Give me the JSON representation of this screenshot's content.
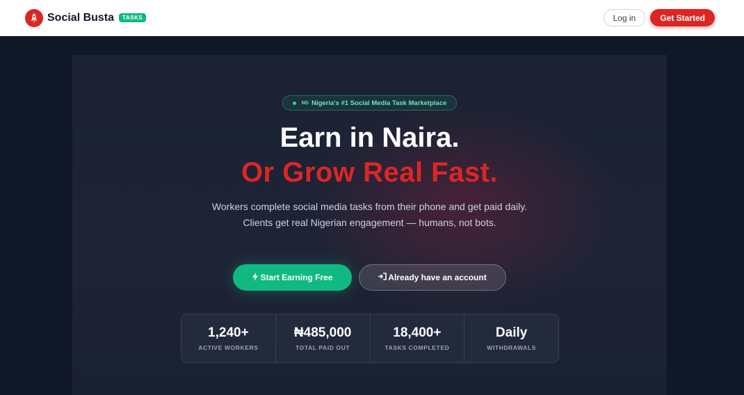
{
  "nav": {
    "brand_name": "Social Busta",
    "brand_badge": "TASKS",
    "login_label": "Log in",
    "get_started_label": "Get Started"
  },
  "hero": {
    "tag_flag": "NG",
    "tag_text": "Nigeria's #1 Social Media Task Marketplace",
    "headline_1": "Earn in Naira.",
    "headline_2": "Or Grow Real Fast.",
    "subtitle_1": "Workers complete social media tasks from their phone and get paid daily.",
    "subtitle_2": "Clients get real Nigerian engagement — humans, not bots.",
    "cta_primary": "Start Earning Free",
    "cta_secondary": "Already have an account"
  },
  "stats": [
    {
      "value": "1,240+",
      "label": "ACTIVE WORKERS"
    },
    {
      "value": "₦485,000",
      "label": "TOTAL PAID OUT"
    },
    {
      "value": "18,400+",
      "label": "TASKS COMPLETED"
    },
    {
      "value": "Daily",
      "label": "WITHDRAWALS"
    }
  ],
  "colors": {
    "brand_red": "#dc2626",
    "brand_green": "#10b981",
    "dark_bg": "#101727"
  },
  "icons": {
    "logo": "rocket-icon",
    "cta_primary": "lightning-icon",
    "cta_secondary": "login-icon"
  }
}
